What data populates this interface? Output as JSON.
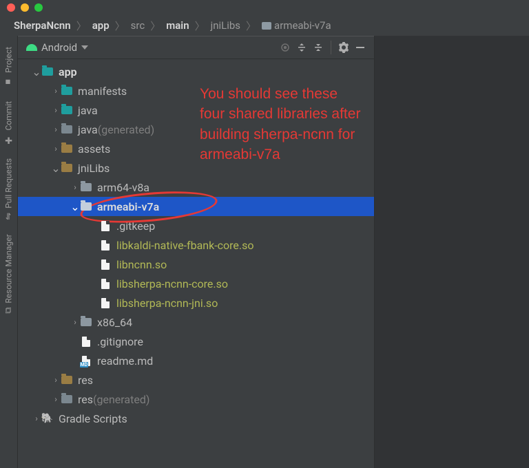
{
  "breadcrumb": {
    "segments": [
      {
        "label": "SherpaNcnn",
        "bold": true
      },
      {
        "label": "app",
        "bold": true
      },
      {
        "label": "src",
        "bold": false
      },
      {
        "label": "main",
        "bold": true
      },
      {
        "label": "jniLibs",
        "bold": false
      },
      {
        "label": "armeabi-v7a",
        "bold": false,
        "icon": true
      }
    ]
  },
  "panel": {
    "title": "Android"
  },
  "gutter": {
    "items": [
      {
        "label": "Project",
        "icon": "■"
      },
      {
        "label": "Commit",
        "icon": "✚"
      },
      {
        "label": "Pull Requests",
        "icon": "⇋"
      },
      {
        "label": "Resource Manager",
        "icon": "⧉"
      }
    ]
  },
  "annotation": {
    "text": "You should see these four shared libraries after building sherpa-ncnn for armeabi-v7a"
  },
  "tree": [
    {
      "d": 0,
      "chev": "down",
      "ico": "folder teal",
      "name": "app",
      "bold": true
    },
    {
      "d": 1,
      "chev": "right",
      "ico": "folder teal",
      "name": "manifests"
    },
    {
      "d": 1,
      "chev": "right",
      "ico": "folder teal",
      "name": "java"
    },
    {
      "d": 1,
      "chev": "right",
      "ico": "folder id",
      "name": "java",
      "suffix": "(generated)"
    },
    {
      "d": 1,
      "chev": "right",
      "ico": "folder orange",
      "name": "assets"
    },
    {
      "d": 1,
      "chev": "down",
      "ico": "folder orange",
      "name": "jniLibs"
    },
    {
      "d": 2,
      "chev": "right",
      "ico": "folder",
      "name": "arm64-v8a"
    },
    {
      "d": 2,
      "chev": "down",
      "ico": "folder sel",
      "name": "armeabi-v7a",
      "bold": true,
      "sel": true
    },
    {
      "d": 3,
      "chev": "",
      "ico": "file",
      "name": ".gitkeep"
    },
    {
      "d": 3,
      "chev": "",
      "ico": "file",
      "name": "libkaldi-native-fbank-core.so",
      "yell": true
    },
    {
      "d": 3,
      "chev": "",
      "ico": "file",
      "name": "libncnn.so",
      "yell": true
    },
    {
      "d": 3,
      "chev": "",
      "ico": "file",
      "name": "libsherpa-ncnn-core.so",
      "yell": true
    },
    {
      "d": 3,
      "chev": "",
      "ico": "file",
      "name": "libsherpa-ncnn-jni.so",
      "yell": true
    },
    {
      "d": 2,
      "chev": "right",
      "ico": "folder",
      "name": "x86_64"
    },
    {
      "d": 2,
      "chev": "",
      "ico": "file git",
      "name": ".gitignore"
    },
    {
      "d": 2,
      "chev": "",
      "ico": "file md",
      "name": "readme.md"
    },
    {
      "d": 1,
      "chev": "right",
      "ico": "folder orange",
      "name": "res"
    },
    {
      "d": 1,
      "chev": "right",
      "ico": "folder id",
      "name": "res",
      "suffix": "(generated)"
    },
    {
      "d": 0,
      "chev": "right",
      "ico": "elephant",
      "name": "Gradle Scripts"
    }
  ]
}
